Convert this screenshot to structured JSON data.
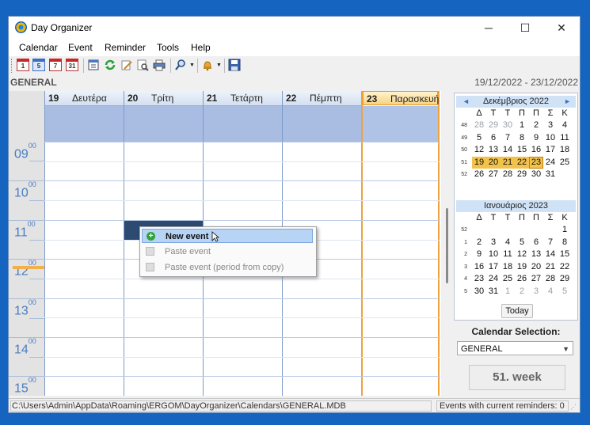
{
  "window": {
    "title": "Day Organizer",
    "minimize_glyph": "─",
    "maximize_glyph": "☐",
    "close_glyph": "✕"
  },
  "menu": [
    "Calendar",
    "Event",
    "Reminder",
    "Tools",
    "Help"
  ],
  "toolbar": {
    "icons": [
      "calendar-day-icon",
      "calendar-workweek-icon",
      "calendar-week-icon",
      "calendar-month-icon",
      "calendar-list-icon",
      "refresh-icon",
      "edit-icon",
      "preview-icon",
      "print-icon",
      "search-icon",
      "bell-icon",
      "save-icon"
    ],
    "cal_day_text": "1",
    "cal_workweek_text": "5",
    "cal_week_text": "7",
    "cal_month_text": "31"
  },
  "calendar_name": "GENERAL",
  "date_range": "19/12/2022 - 23/12/2022",
  "days": [
    {
      "num": "19",
      "name": "Δευτέρα"
    },
    {
      "num": "20",
      "name": "Τρίτη"
    },
    {
      "num": "21",
      "name": "Τετάρτη"
    },
    {
      "num": "22",
      "name": "Πέμπτη"
    },
    {
      "num": "23",
      "name": "Παρασκευή"
    }
  ],
  "hours": [
    {
      "h": "09",
      "m": "00"
    },
    {
      "h": "10",
      "m": "00"
    },
    {
      "h": "11",
      "m": "00"
    },
    {
      "h": "12",
      "m": "00"
    },
    {
      "h": "13",
      "m": "00"
    },
    {
      "h": "14",
      "m": "00"
    },
    {
      "h": "15",
      "m": "00"
    }
  ],
  "context_menu": {
    "new_event": "New event",
    "paste_event": "Paste event",
    "paste_event_copy": "Paste event (period from copy)"
  },
  "mini_calendar": {
    "dow": [
      "Δ",
      "Τ",
      "Τ",
      "Π",
      "Π",
      "Σ",
      "Κ"
    ],
    "dec": {
      "title": "Δεκέμβριος 2022",
      "weeks": [
        {
          "wk": "48",
          "days": [
            "28",
            "29",
            "30",
            "1",
            "2",
            "3",
            "4"
          ]
        },
        {
          "wk": "49",
          "days": [
            "5",
            "6",
            "7",
            "8",
            "9",
            "10",
            "11"
          ]
        },
        {
          "wk": "50",
          "days": [
            "12",
            "13",
            "14",
            "15",
            "16",
            "17",
            "18"
          ]
        },
        {
          "wk": "51",
          "days": [
            "19",
            "20",
            "21",
            "22",
            "23",
            "24",
            "25"
          ]
        },
        {
          "wk": "52",
          "days": [
            "26",
            "27",
            "28",
            "29",
            "30",
            "31",
            ""
          ]
        }
      ]
    },
    "jan": {
      "title": "Ιανουάριος 2023",
      "weeks": [
        {
          "wk": "52",
          "days": [
            "",
            "",
            "",
            "",
            "",
            "",
            "1"
          ]
        },
        {
          "wk": "1",
          "days": [
            "2",
            "3",
            "4",
            "5",
            "6",
            "7",
            "8"
          ]
        },
        {
          "wk": "2",
          "days": [
            "9",
            "10",
            "11",
            "12",
            "13",
            "14",
            "15"
          ]
        },
        {
          "wk": "3",
          "days": [
            "16",
            "17",
            "18",
            "19",
            "20",
            "21",
            "22"
          ]
        },
        {
          "wk": "4",
          "days": [
            "23",
            "24",
            "25",
            "26",
            "27",
            "28",
            "29"
          ]
        },
        {
          "wk": "5",
          "days": [
            "30",
            "31",
            "1",
            "2",
            "3",
            "4",
            "5"
          ]
        }
      ]
    },
    "today_label": "Today",
    "prev_glyph": "◄",
    "next_glyph": "►"
  },
  "calendar_selection": {
    "label": "Calendar Selection:",
    "value": "GENERAL"
  },
  "week_label": "51. week",
  "status": {
    "path": "C:\\Users\\Admin\\AppData\\Roaming\\ERGOM\\DayOrganizer\\Calendars\\GENERAL.MDB",
    "reminders": "Events with current reminders: 0"
  },
  "colors": {
    "accent": "#1565c0",
    "today_border": "#f0a13c",
    "selected_slot": "#2d4a73",
    "allday_bg": "#a9bde3"
  }
}
